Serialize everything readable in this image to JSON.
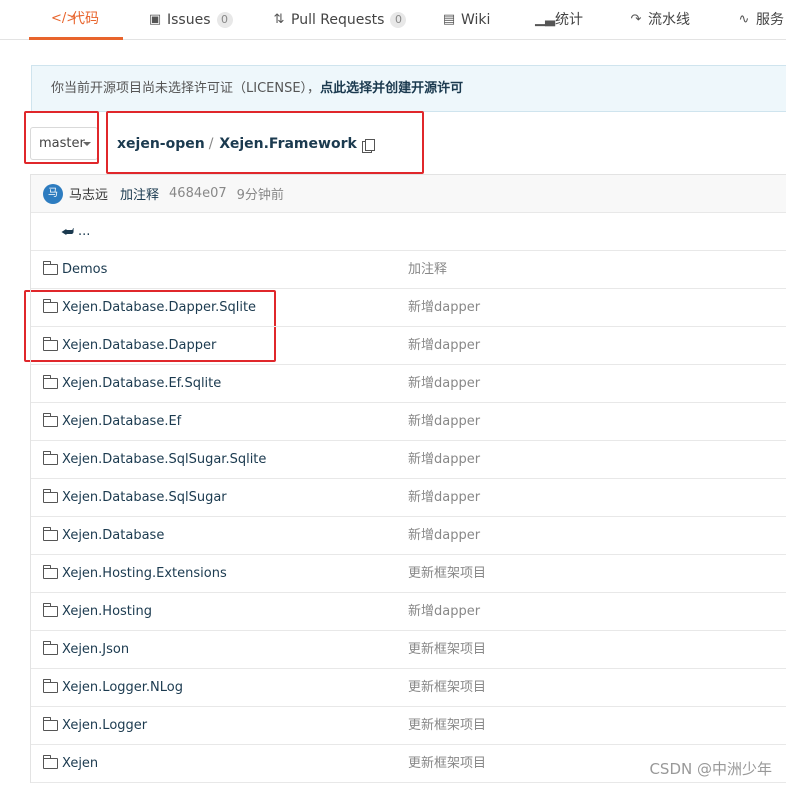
{
  "tabs": [
    {
      "label": "代码",
      "icon": "code-icon",
      "active": true
    },
    {
      "label": "Issues",
      "icon": "issues-icon",
      "badge": "0"
    },
    {
      "label": "Pull Requests",
      "icon": "pull-request-icon",
      "badge": "0"
    },
    {
      "label": "Wiki",
      "icon": "wiki-icon"
    },
    {
      "label": "统计",
      "icon": "stats-icon"
    },
    {
      "label": "流水线",
      "icon": "pipeline-icon"
    },
    {
      "label": "服务",
      "icon": "service-icon"
    }
  ],
  "notice": {
    "text": "你当前开源项目尚未选择许可证（LICENSE），",
    "link": "点此选择并创建开源许可"
  },
  "branch": {
    "label": "master"
  },
  "breadcrumb": {
    "owner": "xejen-open",
    "separator": "/",
    "repo": "Xejen.Framework"
  },
  "commit": {
    "avatar_text": "马",
    "author": "马志远",
    "message": "加注释",
    "sha": "4684e07",
    "time": "9分钟前"
  },
  "up_label": "...",
  "files": [
    {
      "name": "Demos",
      "desc": "加注释"
    },
    {
      "name": "Xejen.Database.Dapper.Sqlite",
      "desc": "新增dapper"
    },
    {
      "name": "Xejen.Database.Dapper",
      "desc": "新增dapper"
    },
    {
      "name": "Xejen.Database.Ef.Sqlite",
      "desc": "新增dapper"
    },
    {
      "name": "Xejen.Database.Ef",
      "desc": "新增dapper"
    },
    {
      "name": "Xejen.Database.SqlSugar.Sqlite",
      "desc": "新增dapper"
    },
    {
      "name": "Xejen.Database.SqlSugar",
      "desc": "新增dapper"
    },
    {
      "name": "Xejen.Database",
      "desc": "新增dapper"
    },
    {
      "name": "Xejen.Hosting.Extensions",
      "desc": "更新框架项目"
    },
    {
      "name": "Xejen.Hosting",
      "desc": "新增dapper"
    },
    {
      "name": "Xejen.Json",
      "desc": "更新框架项目"
    },
    {
      "name": "Xejen.Logger.NLog",
      "desc": "更新框架项目"
    },
    {
      "name": "Xejen.Logger",
      "desc": "更新框架项目"
    },
    {
      "name": "Xejen",
      "desc": "更新框架项目"
    }
  ],
  "watermark": "CSDN @中洲少年",
  "colors": {
    "accent": "#e8642c",
    "annotation": "#e0272b",
    "link": "#1b3a4f"
  }
}
